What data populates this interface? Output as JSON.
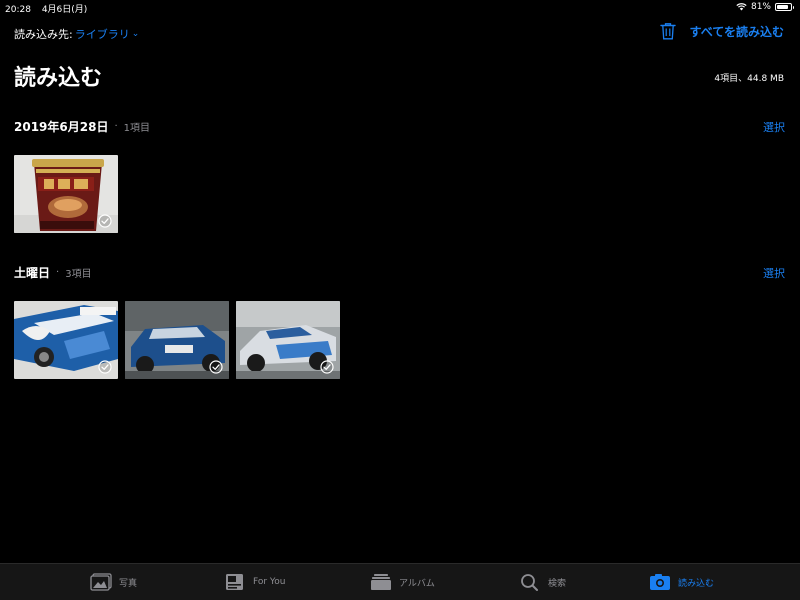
{
  "status_bar": {
    "time": "20:28",
    "date": "4月6日(月)",
    "battery": "81%",
    "battery_level": 0.81
  },
  "header": {
    "source_label": "読み込み先:",
    "source_value": "ライブラリ",
    "import_all_label": "すべてを読み込む",
    "page_title": "読み込む",
    "total_info": "4項目、44.8 MB"
  },
  "sections": [
    {
      "date": "2019年6月28日",
      "dot": "·",
      "count": "1項目",
      "select_label": "選択"
    },
    {
      "date": "土曜日",
      "dot": "·",
      "count": "3項目",
      "select_label": "選択"
    }
  ],
  "tabs": [
    {
      "label": "写真",
      "icon": "photos-icon"
    },
    {
      "label": "For You",
      "icon": "for-you-icon"
    },
    {
      "label": "アルバム",
      "icon": "albums-icon"
    },
    {
      "label": "検索",
      "icon": "search-icon"
    },
    {
      "label": "読み込む",
      "icon": "import-icon"
    }
  ],
  "colors": {
    "accent": "#1a7ff0",
    "background": "#000000",
    "tab_bar": "#161616",
    "secondary_text": "#8e8e93"
  }
}
